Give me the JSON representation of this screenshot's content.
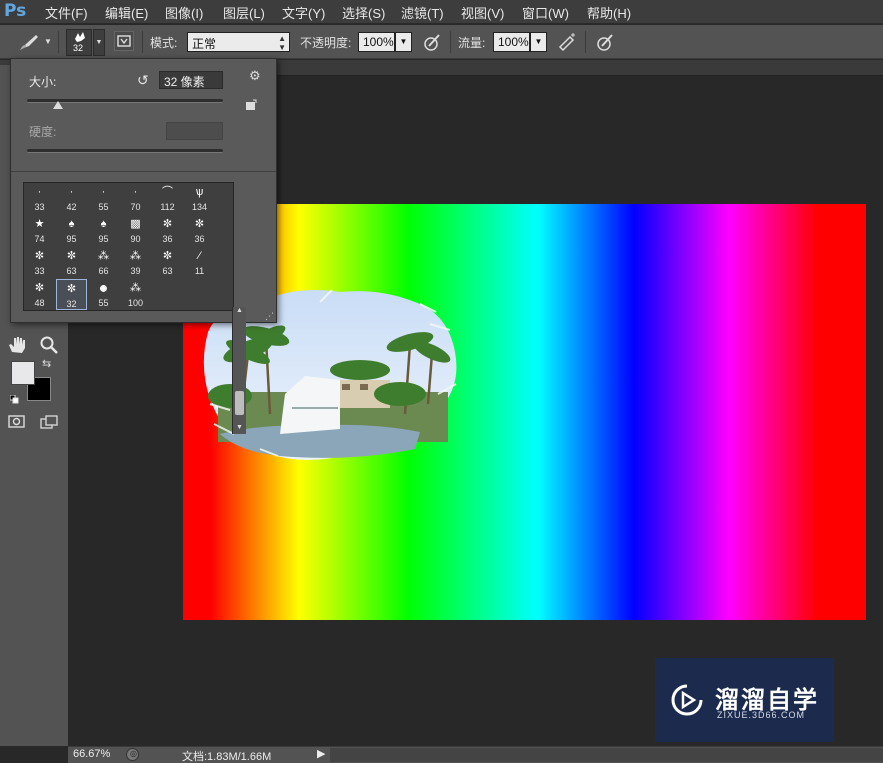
{
  "app": {
    "logo": "Ps"
  },
  "menu": [
    "文件(F)",
    "编辑(E)",
    "图像(I)",
    "图层(L)",
    "文字(Y)",
    "选择(S)",
    "滤镜(T)",
    "视图(V)",
    "窗口(W)",
    "帮助(H)"
  ],
  "options": {
    "brush_size": "32",
    "mode_label": "模式:",
    "mode_value": "正常",
    "opacity_label": "不透明度:",
    "opacity_value": "100%",
    "flow_label": "流量:",
    "flow_value": "100%"
  },
  "brush_panel": {
    "size_label": "大小:",
    "size_value": "32 像素",
    "size_fraction": 0.16,
    "hardness_label": "硬度:",
    "brushes": [
      [
        "33",
        "42",
        "55",
        "70",
        "112",
        "134"
      ],
      [
        "74",
        "95",
        "95",
        "90",
        "36",
        "36"
      ],
      [
        "33",
        "63",
        "66",
        "39",
        "63",
        "11"
      ],
      [
        "48",
        "32",
        "55",
        "100"
      ]
    ],
    "selected_brush": "32"
  },
  "status": {
    "zoom": "66.67%",
    "doc_info": "文档:1.83M/1.66M"
  },
  "watermark": {
    "brand": "溜溜自学",
    "url": "ZIXUE.3D66.COM"
  },
  "colors": {
    "foreground": "#e8e8ea",
    "background": "#000000",
    "accent": "#62a7e0"
  }
}
